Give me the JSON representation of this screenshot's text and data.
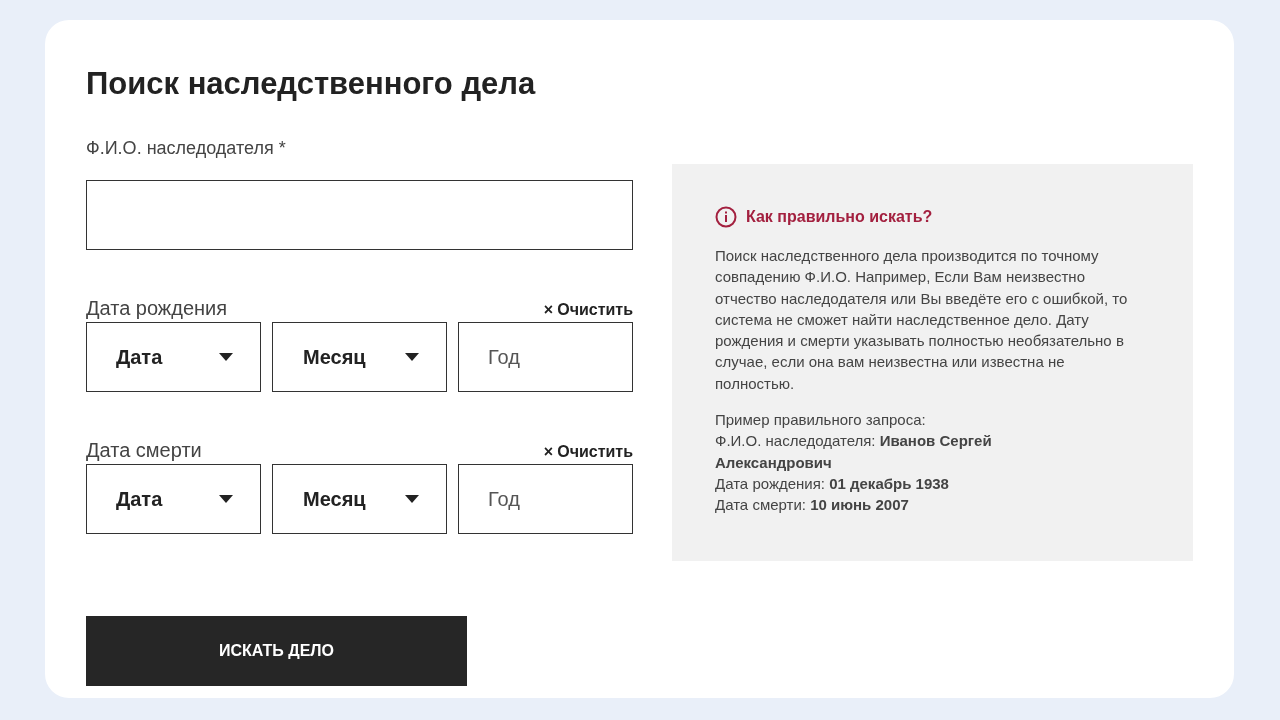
{
  "title": "Поиск наследственного дела",
  "name_field": {
    "label": "Ф.И.О. наследодателя *"
  },
  "date_groups": [
    {
      "label": "Дата рождения",
      "clear": {
        "icon": "×",
        "label": "Очистить"
      },
      "day": "Дата",
      "month": "Месяц",
      "year_placeholder": "Год"
    },
    {
      "label": "Дата смерти",
      "clear": {
        "icon": "×",
        "label": "Очистить"
      },
      "day": "Дата",
      "month": "Месяц",
      "year_placeholder": "Год"
    }
  ],
  "submit": "ИСКАТЬ ДЕЛО",
  "help": {
    "title": "Как правильно искать?",
    "text": "Поиск наследственного дела производится по точному совпадению Ф.И.О. Например, Если Вам неизвестно отчество наследодателя или Вы введёте его с ошибкой, то система не сможет найти наследственное дело. Дату рождения и смерти указывать полностью необязательно в случае, если она вам неизвестна или известна не полностью.",
    "example_title": "Пример правильного запроса:",
    "example_lines": [
      "Ф.И.О. наследодателя: **Иванов Сергей Александрович**",
      "Дата рождения: **01 декабрь 1938**",
      "Дата смерти: **10 июнь 2007**"
    ]
  }
}
